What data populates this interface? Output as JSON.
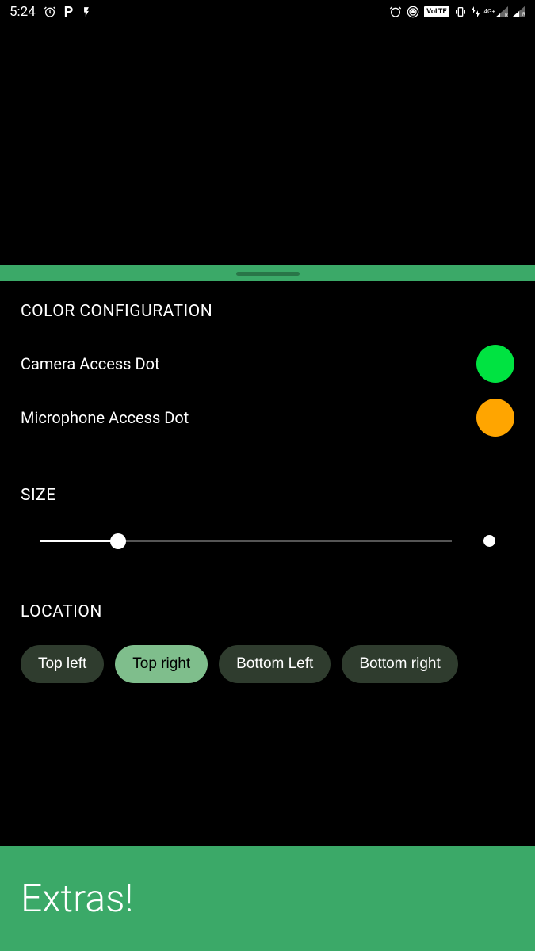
{
  "status_bar": {
    "time": "5:24",
    "volte": "VoLTE",
    "network": "4G+",
    "roaming": "R"
  },
  "sections": {
    "color_config": {
      "header": "COLOR CONFIGURATION",
      "camera_label": "Camera Access Dot",
      "camera_color": "#00e341",
      "mic_label": "Microphone Access Dot",
      "mic_color": "orange"
    },
    "size": {
      "header": "SIZE",
      "value": 19
    },
    "location": {
      "header": "LOCATION",
      "options": {
        "top_left": "Top left",
        "top_right": "Top right",
        "bottom_left": "Bottom Left",
        "bottom_right": "Bottom right"
      },
      "selected": "top_right"
    }
  },
  "banner": {
    "text": "Extras!"
  }
}
